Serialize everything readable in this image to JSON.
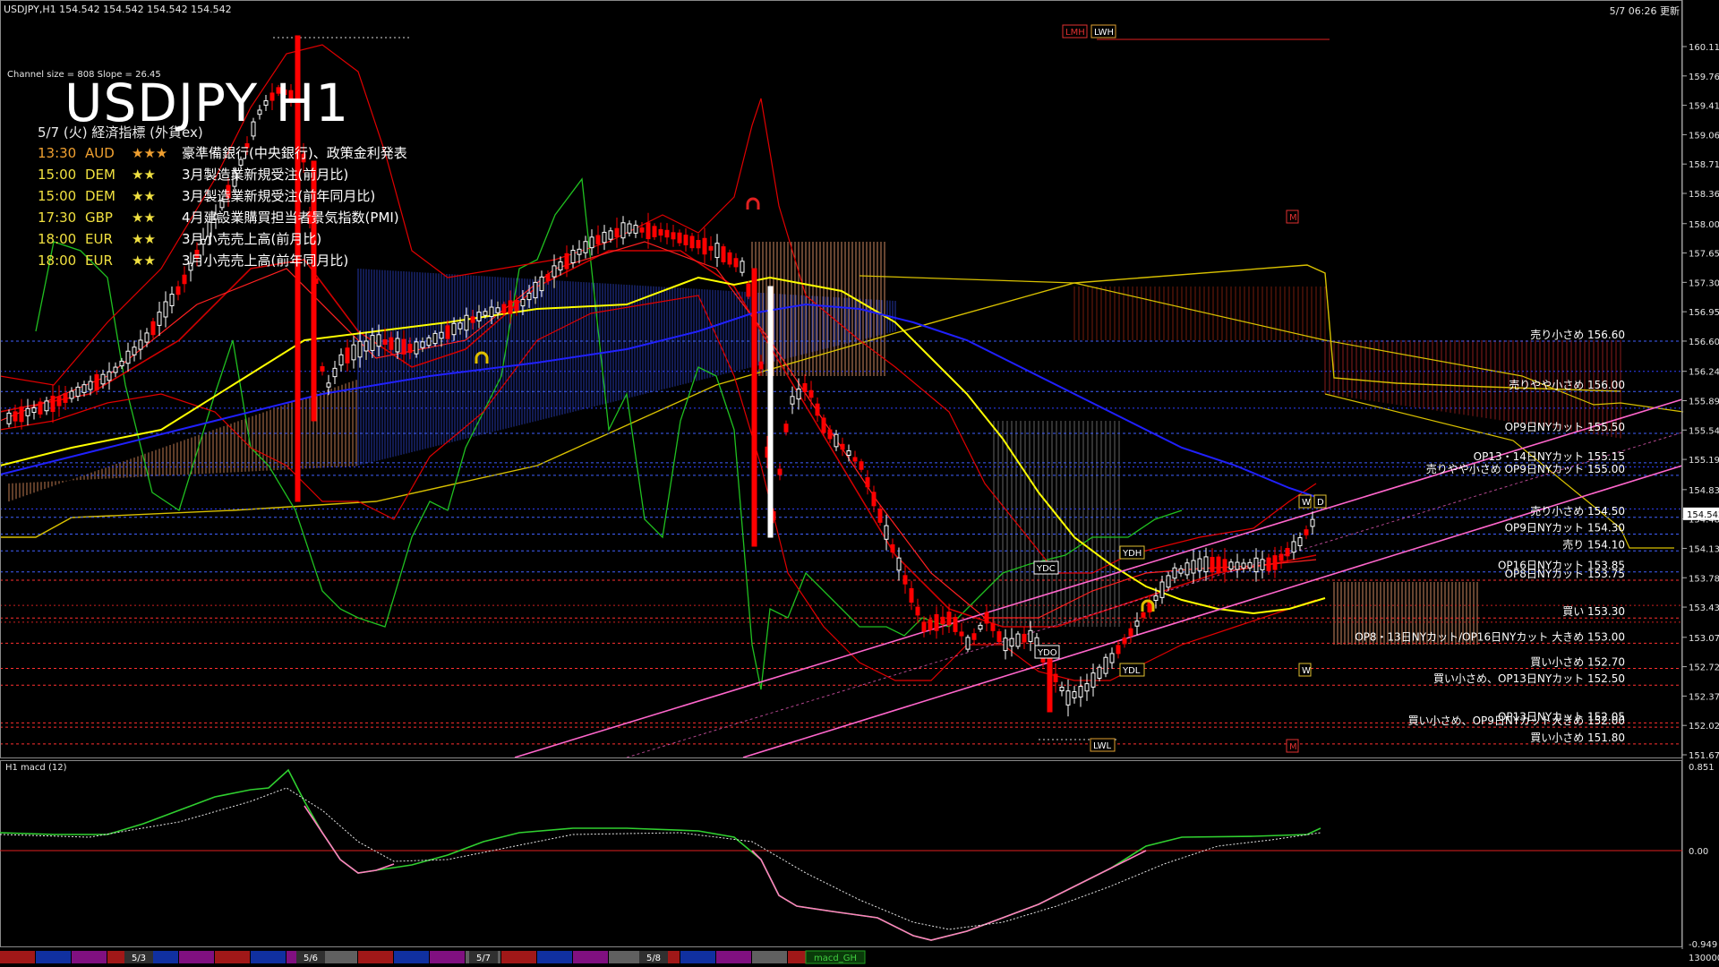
{
  "window": {
    "title": "USDJPY,H1  154.542 154.542 154.542 154.542",
    "server_time": "5/7 06:26 更新"
  },
  "overlay": {
    "channel_info": "Channel size = 808 Slope = 26.45",
    "big_title": "USDJPY H1",
    "econ_header": "5/7 (火) 経済指標 (外貨ex)",
    "econ_events": [
      {
        "time": "13:30",
        "currency": "AUD",
        "stars": "★★★",
        "text": "豪準備銀行(中央銀行)、政策金利発表",
        "color": "#f0a030"
      },
      {
        "time": "15:00",
        "currency": "DEM",
        "stars": "★★",
        "text": "3月製造業新規受注(前月比)",
        "color": "#f0e040"
      },
      {
        "time": "15:00",
        "currency": "DEM",
        "stars": "★★",
        "text": "3月製造業新規受注(前年同月比)",
        "color": "#f0e040"
      },
      {
        "time": "17:30",
        "currency": "GBP",
        "stars": "★★",
        "text": "4月建設業購買担当者景気指数(PMI)",
        "color": "#f0e040"
      },
      {
        "time": "18:00",
        "currency": "EUR",
        "stars": "★★",
        "text": "3月小売売上高(前月比)",
        "color": "#f0e040"
      },
      {
        "time": "18:00",
        "currency": "EUR",
        "stars": "★★",
        "text": "3月小売売上高(前年同月比)",
        "color": "#f0e040"
      }
    ]
  },
  "price_axis": {
    "labels": [
      "160.110",
      "159.760",
      "159.410",
      "159.060",
      "158.710",
      "158.360",
      "158.000",
      "157.650",
      "157.300",
      "156.950",
      "156.600",
      "156.240",
      "155.890",
      "155.540",
      "155.190",
      "154.830",
      "154.480",
      "154.130",
      "153.780",
      "153.430",
      "153.070",
      "152.720",
      "152.370",
      "152.020",
      "151.670"
    ],
    "current_price": "154.542",
    "range": [
      151.6,
      160.4
    ]
  },
  "macd_axis": {
    "label": "H1  macd (12)",
    "top": "0.851",
    "zero": "0.00",
    "bottom": "-0.949"
  },
  "badges": {
    "lmh": "LMH",
    "lwh": "LWH",
    "lwl": "LWL",
    "m": "M",
    "ydh": "YDH",
    "ydl": "YDL",
    "ydc": "YDC",
    "ydo": "YDO",
    "w": "W",
    "d": "D"
  },
  "level_labels": [
    {
      "text": "売り小さめ 156.60",
      "price": 156.6
    },
    {
      "text": "売りやや小さめ 156.00",
      "price": 156.0
    },
    {
      "text": "OP9日NYカット 155.50",
      "price": 155.5
    },
    {
      "text": "OP13・14日NYカット 155.15",
      "price": 155.15
    },
    {
      "text": "売りやや小さめ OP9日NYカット 155.00",
      "price": 155.0
    },
    {
      "text": "売り小さめ 154.50",
      "price": 154.5
    },
    {
      "text": "OP9日NYカット 154.30",
      "price": 154.3
    },
    {
      "text": "売り 154.10",
      "price": 154.1
    },
    {
      "text": "OP16日NYカット 153.85",
      "price": 153.85
    },
    {
      "text": "OP8日NYカット 153.75",
      "price": 153.75
    },
    {
      "text": "買い 153.30",
      "price": 153.3
    },
    {
      "text": "OP8・13日NYカット/OP16日NYカット 大きめ 153.00",
      "price": 153.0
    },
    {
      "text": "買い小さめ 152.70",
      "price": 152.7
    },
    {
      "text": "買い小さめ、OP13日NYカット 152.50",
      "price": 152.5
    },
    {
      "text": "OP13日NYカット 152.05",
      "price": 152.05
    },
    {
      "text": "買い小さめ、OP9日NYカット大きめ 152.00",
      "price": 152.0
    },
    {
      "text": "買い小さめ 151.80",
      "price": 151.8
    }
  ],
  "bottom_bar": {
    "date_labels": [
      "5/3",
      "5/6",
      "5/7",
      "5/8"
    ],
    "macd_tag": "macd_GH",
    "volume": "130000"
  },
  "colors": {
    "bull": "#ffffff",
    "bear": "#ff0000",
    "ma_fast": "#ffff00",
    "ma_slow": "#2020ff",
    "bands": "#e00000",
    "span": "#20c020",
    "channel": "#ff66cc",
    "cloud": "#f0a070",
    "level": "#4060ff",
    "level_red": "#ff3030"
  }
}
